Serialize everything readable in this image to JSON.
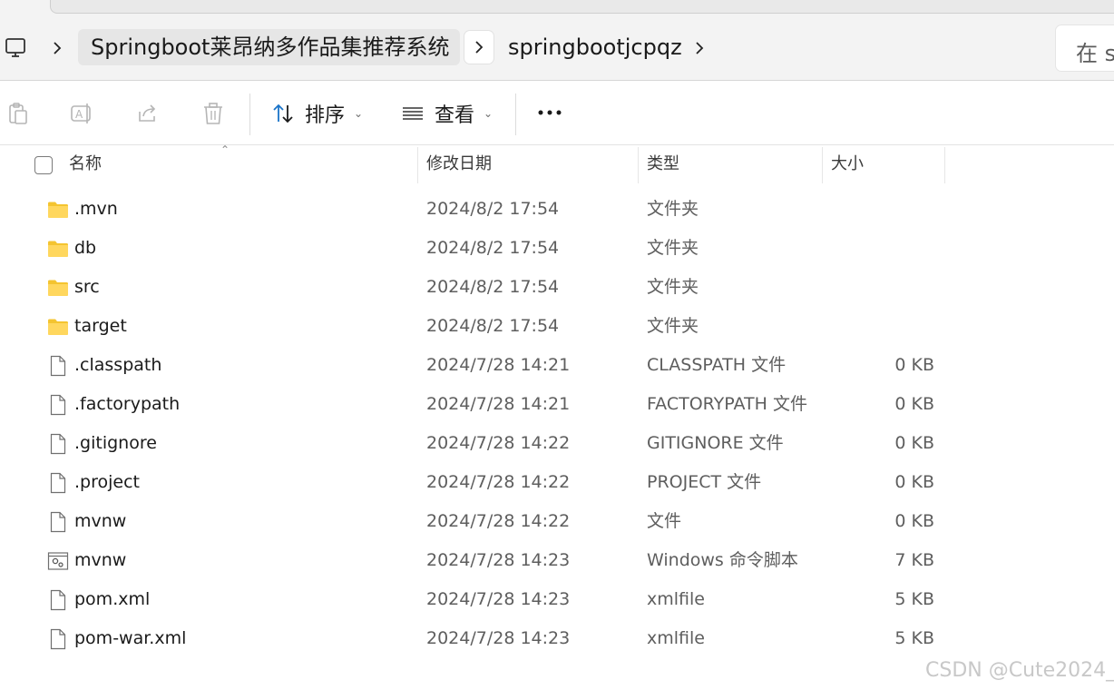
{
  "address_bar": {
    "breadcrumbs": [
      "Springboot莱昂纳多作品集推荐系统",
      "springbootjcpqz"
    ],
    "search_placeholder": "在 s"
  },
  "toolbar": {
    "sort_label": "排序",
    "view_label": "查看",
    "more_label": "..."
  },
  "columns": {
    "name": "名称",
    "date": "修改日期",
    "type": "类型",
    "size": "大小"
  },
  "files": [
    {
      "name": ".mvn",
      "date": "2024/8/2 17:54",
      "type": "文件夹",
      "size": "",
      "icon": "folder-icon"
    },
    {
      "name": "db",
      "date": "2024/8/2 17:54",
      "type": "文件夹",
      "size": "",
      "icon": "folder-icon"
    },
    {
      "name": "src",
      "date": "2024/8/2 17:54",
      "type": "文件夹",
      "size": "",
      "icon": "folder-icon"
    },
    {
      "name": "target",
      "date": "2024/8/2 17:54",
      "type": "文件夹",
      "size": "",
      "icon": "folder-icon"
    },
    {
      "name": ".classpath",
      "date": "2024/7/28 14:21",
      "type": "CLASSPATH 文件",
      "size": "0 KB",
      "icon": "file-icon"
    },
    {
      "name": ".factorypath",
      "date": "2024/7/28 14:21",
      "type": "FACTORYPATH 文件",
      "size": "0 KB",
      "icon": "file-icon"
    },
    {
      "name": ".gitignore",
      "date": "2024/7/28 14:22",
      "type": "GITIGNORE 文件",
      "size": "0 KB",
      "icon": "file-icon"
    },
    {
      "name": ".project",
      "date": "2024/7/28 14:22",
      "type": "PROJECT 文件",
      "size": "0 KB",
      "icon": "file-icon"
    },
    {
      "name": "mvnw",
      "date": "2024/7/28 14:22",
      "type": "文件",
      "size": "0 KB",
      "icon": "file-icon"
    },
    {
      "name": "mvnw",
      "date": "2024/7/28 14:23",
      "type": "Windows 命令脚本",
      "size": "7 KB",
      "icon": "script-file-icon"
    },
    {
      "name": "pom.xml",
      "date": "2024/7/28 14:23",
      "type": "xmlfile",
      "size": "5 KB",
      "icon": "file-icon"
    },
    {
      "name": "pom-war.xml",
      "date": "2024/7/28 14:23",
      "type": "xmlfile",
      "size": "5 KB",
      "icon": "file-icon"
    }
  ],
  "watermark": "CSDN @Cute2024_",
  "colors": {
    "folder": "#f4c430",
    "accent": "#1a73c8"
  }
}
